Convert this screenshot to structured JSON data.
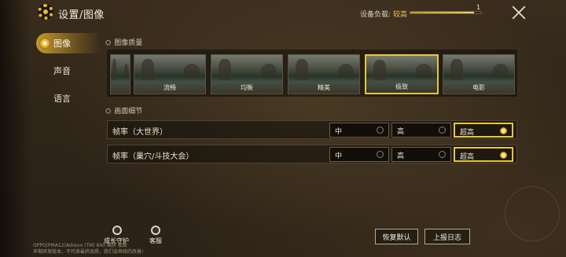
{
  "header": {
    "title": "设置/图像",
    "load_label": "设备负载:",
    "load_value": "较高",
    "load_num": "1",
    "load_level": 0.9
  },
  "sidebar": {
    "items": [
      {
        "label": "图像",
        "active": true
      },
      {
        "label": "声音",
        "active": false
      },
      {
        "label": "语言",
        "active": false
      }
    ]
  },
  "quality": {
    "title": "图像质量",
    "options": [
      {
        "label": ""
      },
      {
        "label": "流畅"
      },
      {
        "label": "均衡"
      },
      {
        "label": "精美"
      },
      {
        "label": "极致",
        "selected": true
      },
      {
        "label": "电影"
      }
    ]
  },
  "details": {
    "title": "画面细节",
    "rows": [
      {
        "label": "帧率（大世界）",
        "options": [
          "中",
          "高",
          "超高"
        ],
        "selected": "超高"
      },
      {
        "label": "帧率（巢穴/斗技大会）",
        "options": [
          "中",
          "高",
          "超高"
        ],
        "selected": "超高"
      }
    ]
  },
  "bottom": {
    "guard_label": "成长守护",
    "service_label": "客服",
    "device_info_line1": "OPPO(PMA12)Adreno (TM) 840   画质  极致",
    "device_info_line2": "早期研发版本，不代表最终品质，我们会继续的改善!",
    "reset_label": "恢复默认",
    "log_label": "上报日志"
  },
  "colors": {
    "accent": "#e8c63a",
    "background": "#2e2418"
  }
}
